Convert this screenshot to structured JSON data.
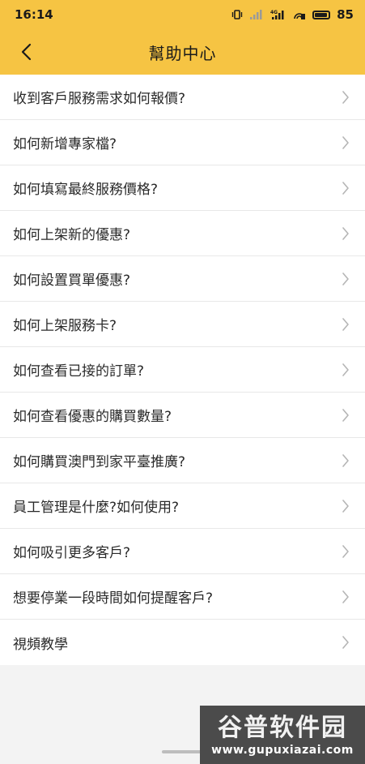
{
  "status_bar": {
    "time": "16:14",
    "battery": "85",
    "icons": [
      "vibrate-icon",
      "signal-icon",
      "4g-signal-icon",
      "hd-icon",
      "battery-icon"
    ]
  },
  "header": {
    "title": "幫助中心",
    "back_icon": "chevron-left-icon"
  },
  "list": {
    "items": [
      {
        "label": "收到客戶服務需求如何報價?"
      },
      {
        "label": "如何新增專家檔?"
      },
      {
        "label": "如何填寫最終服務價格?"
      },
      {
        "label": "如何上架新的優惠?"
      },
      {
        "label": "如何設置買單優惠?"
      },
      {
        "label": "如何上架服務卡?"
      },
      {
        "label": "如何查看已接的訂單?"
      },
      {
        "label": "如何查看優惠的購買數量?"
      },
      {
        "label": "如何購買澳門到家平臺推廣?"
      },
      {
        "label": "員工管理是什麼?如何使用?"
      },
      {
        "label": "如何吸引更多客戶?"
      },
      {
        "label": "想要停業一段時間如何提醒客戶?"
      },
      {
        "label": "視頻教學"
      }
    ]
  },
  "watermark": {
    "title": "谷普软件园",
    "url": "www.gupuxiazai.com"
  },
  "colors": {
    "header_bg": "#f6c443",
    "page_bg": "#f3f3f3",
    "row_bg": "#ffffff"
  }
}
